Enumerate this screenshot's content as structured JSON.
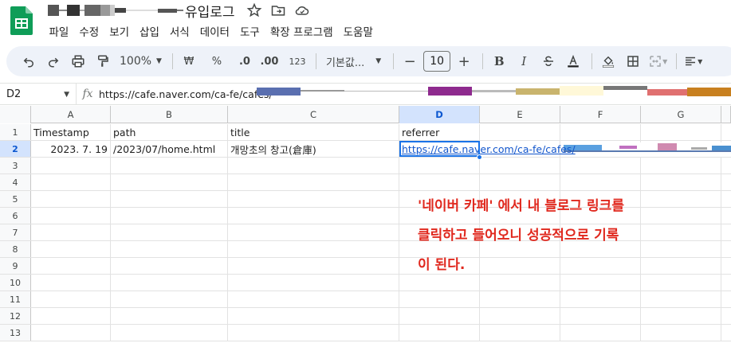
{
  "app": {
    "title_suffix": "유입로그"
  },
  "menu": [
    "파일",
    "수정",
    "보기",
    "삽입",
    "서식",
    "데이터",
    "도구",
    "확장 프로그램",
    "도움말"
  ],
  "toolbar": {
    "zoom": "100%",
    "currency": "₩",
    "percent": "%",
    "dec_decrease": ".0",
    "dec_increase": ".00",
    "number_format": "123",
    "font": "기본값...",
    "font_size": "10",
    "minus": "−",
    "plus": "+",
    "bold": "B",
    "italic": "I"
  },
  "formula_bar": {
    "cell_ref": "D2",
    "fx": "fx",
    "content": "https://cafe.naver.com/ca-fe/cafes/"
  },
  "sheet": {
    "columns": [
      "A",
      "B",
      "C",
      "D",
      "E",
      "F",
      "G"
    ],
    "rows": [
      "1",
      "2",
      "3",
      "4",
      "5",
      "6",
      "7",
      "8",
      "9",
      "10",
      "11",
      "12",
      "13"
    ],
    "header": {
      "a": "Timestamp",
      "b": "path",
      "c": "title",
      "d": "referrer"
    },
    "row2": {
      "a": "2023. 7. 19",
      "b": "/2023/07/home.html",
      "c": "개망초의 창고(倉庫)",
      "d": "https://cafe.naver.com/ca-fe/cafes/"
    }
  },
  "annotation": {
    "line1": "'네이버 카페' 에서 내 블로그 링크를",
    "line2": "클릭하고 들어오니 성공적으로 기록",
    "line3": "이 된다."
  },
  "colors": {
    "accent": "#1a73e8",
    "link": "#1155cc",
    "annotation": "#e0281e",
    "toolbar_bg": "#eef2f9",
    "sheets_green": "#0f9d58"
  }
}
